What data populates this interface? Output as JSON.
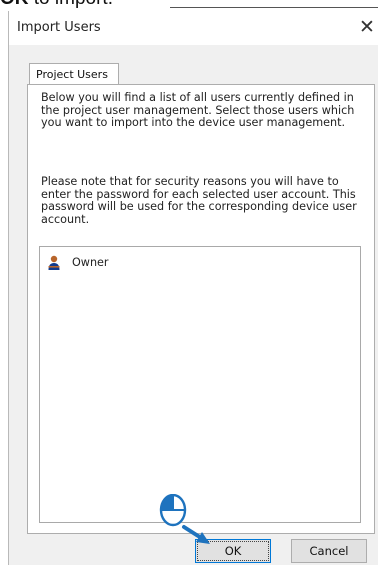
{
  "caption": {
    "bold": "OK",
    "rest": " to import."
  },
  "dialog": {
    "title": "Import Users",
    "close_glyph": "✕",
    "tab_label": "Project Users",
    "description_1": "Below you will find a list of all users currently defined in the project user management. Select those users which you want to import into the device user management.",
    "description_2": "Please note that for security reasons you will have to enter the password for each selected user account. This password will be used for the corresponding device user account.",
    "users": [
      {
        "name": "Owner",
        "icon": "user-icon"
      }
    ],
    "ok_label": "OK",
    "cancel_label": "Cancel"
  },
  "colors": {
    "accent": "#0078d7",
    "cursor_fill": "#1e73be",
    "user_icon_head": "#b8652b",
    "user_icon_body": "#123a8c"
  }
}
